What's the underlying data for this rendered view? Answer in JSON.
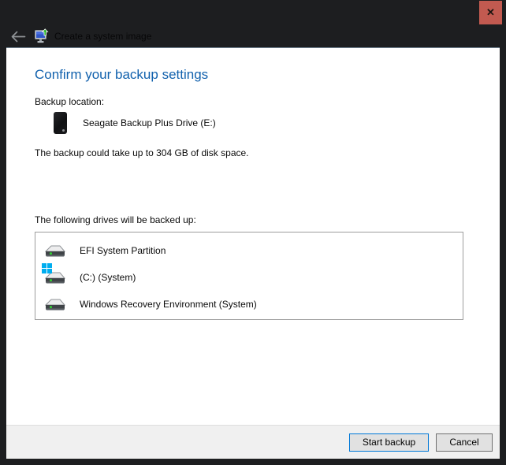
{
  "window": {
    "title": "Create a system image",
    "close_glyph": "✕"
  },
  "main": {
    "heading": "Confirm your backup settings",
    "backup_location_label": "Backup location:",
    "backup_target": {
      "name": "Seagate Backup Plus Drive (E:)",
      "icon": "external-drive-icon"
    },
    "space_note": "The backup could take up to 304 GB of disk space.",
    "drives_label": "The following drives will be backed up:",
    "drives": [
      {
        "name": "EFI System Partition",
        "icon": "hard-drive-icon"
      },
      {
        "name": "(C:) (System)",
        "icon": "hard-drive-windows-icon"
      },
      {
        "name": "Windows Recovery Environment (System)",
        "icon": "hard-drive-icon"
      }
    ]
  },
  "footer": {
    "start_button": "Start backup",
    "cancel_button": "Cancel"
  },
  "colors": {
    "heading_blue": "#1161ad",
    "default_button_border": "#0078d7",
    "close_button_bg": "#c25a50",
    "windows_badge_blue": "#00adef",
    "drive_led_green": "#2fd32f",
    "header_bg": "#1d1e20",
    "footer_bg": "#f0f0f0"
  }
}
